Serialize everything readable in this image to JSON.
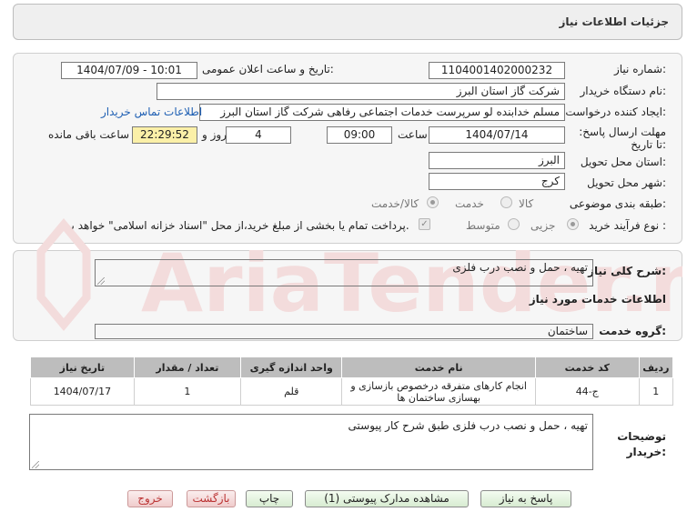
{
  "header": {
    "title": "جزئیات اطلاعات نیاز"
  },
  "form": {
    "need_number_label": "شماره نیاز:",
    "need_number": "1104001402000232",
    "announce_label": "تاریخ و ساعت اعلان عمومی:",
    "announce_value": "1404/07/09 - 10:01",
    "buyer_org_label": "نام دستگاه خریدار:",
    "buyer_org": "شرکت گاز استان البرز",
    "creator_label": "ایجاد کننده درخواست:",
    "creator": "مسلم خدابنده لو سرپرست خدمات اجتماعی رفاهی شرکت گاز استان البرز",
    "contact_link": "اطلاعات تماس خریدار",
    "deadline_label": "مهلت ارسال پاسخ: تا تاریخ:",
    "deadline_date": "1404/07/14",
    "hour_label": "ساعت",
    "deadline_time": "09:00",
    "days_value": "4",
    "days_and_label": "روز و",
    "remaining_time": "22:29:52",
    "remaining_label": "ساعت باقی مانده",
    "province_label": "استان محل تحویل:",
    "province": "البرز",
    "city_label": "شهر محل تحویل:",
    "city": "کرج",
    "category_label": "طبقه بندی موضوعی:",
    "category_options": [
      "کالا",
      "خدمت",
      "کالا/خدمت"
    ],
    "process_label": "نوع فرآیند خرید :",
    "process_options": [
      "جزیی",
      "متوسط"
    ],
    "payment_note": "پرداخت تمام یا بخشی از مبلغ خرید،از محل \"اسناد خزانه اسلامی\" خواهد بود."
  },
  "summary": {
    "label": "شرح کلی نیاز:",
    "value": "تهیه ، حمل و نصب درب فلزی"
  },
  "services": {
    "section_title": "اطلاعات خدمات مورد نیاز",
    "group_label": "گروه خدمت:",
    "group_value": "ساختمان",
    "columns": [
      "ردیف",
      "کد خدمت",
      "نام خدمت",
      "واحد اندازه گیری",
      "تعداد / مقدار",
      "تاریخ نیاز"
    ],
    "rows": [
      {
        "row": "1",
        "code": "ج-44",
        "name": "انجام کارهای متفرقه درخصوص بازسازی و بهسازی ساختمان ها",
        "unit": "قلم",
        "qty": "1",
        "date": "1404/07/17"
      }
    ]
  },
  "buyer_notes": {
    "label": "توضیحات خریدار:",
    "value": "تهیه ، حمل و نصب درب فلزی طبق شرح کار پیوستی"
  },
  "buttons": {
    "reply": "پاسخ به نیاز",
    "attachments": "مشاهده مدارک پیوستی (1)",
    "print": "چاپ",
    "back": "بازگشت",
    "exit": "خروج"
  },
  "watermark": {
    "brand": "AriaTender.net"
  },
  "colors": {
    "panel_bg": "#f6f6f6",
    "table_header": "#bdbdbd",
    "remaining_bg": "#fbf0a8",
    "link": "#1e5fb3",
    "button_green": "#d7ecd1",
    "button_red": "#f0cccc",
    "watermark": "#f3dcdc"
  }
}
